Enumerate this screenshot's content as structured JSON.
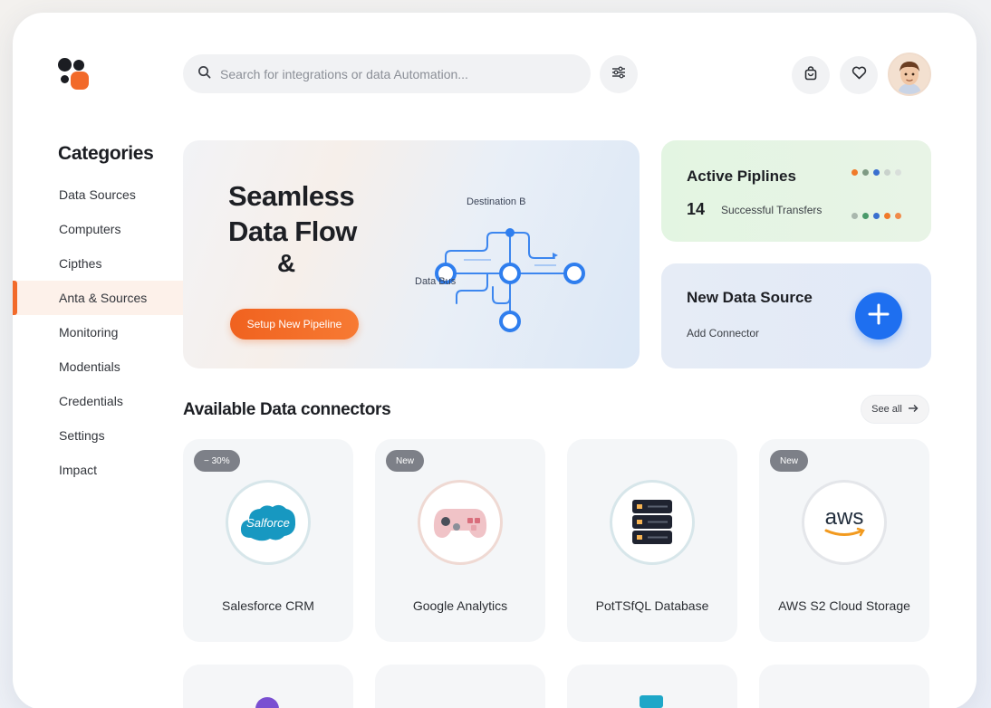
{
  "search": {
    "placeholder": "Search for integrations or data Automation..."
  },
  "header": {
    "filter_icon": "sliders-icon",
    "bag_icon": "shopping-bag-icon",
    "heart_icon": "heart-icon",
    "avatar_icon": "user-avatar"
  },
  "sidebar": {
    "title": "Categories",
    "items": [
      {
        "label": "Data Sources"
      },
      {
        "label": "Computers"
      },
      {
        "label": "Cipthes"
      },
      {
        "label": "Anta & Sources",
        "active": true
      },
      {
        "label": "Monitoring"
      },
      {
        "label": "Modentials"
      },
      {
        "label": "Credentials"
      },
      {
        "label": "Settings"
      },
      {
        "label": "Impact"
      }
    ]
  },
  "hero": {
    "title_line1": "Seamless",
    "title_line2": "Data Flow",
    "title_amp": "&",
    "button_label": "Setup New Pipeline",
    "diagram_label_top": "Destination B",
    "diagram_label_left": "Data Bus"
  },
  "active_pipelines": {
    "title": "Active Piplines",
    "count": "14",
    "subtitle": "Successful Transfers"
  },
  "new_source": {
    "title": "New Data Source",
    "subtitle": "Add Connector"
  },
  "connectors": {
    "title": "Available Data connectors",
    "see_all": "See all",
    "items": [
      {
        "name": "Salesforce CRM",
        "badge": "− 30%",
        "logo_text": "Salforce"
      },
      {
        "name": "Google Analytics",
        "badge": "New",
        "logo_text": ""
      },
      {
        "name": "PotTSfQL Database",
        "badge": "",
        "logo_text": ""
      },
      {
        "name": "AWS S2 Cloud Storage",
        "badge": "New",
        "logo_text": "aws"
      }
    ]
  },
  "colors": {
    "accent": "#f26a2a",
    "primary_blue": "#1e6ff0",
    "pipeline_card": "#e3f5e2",
    "new_source_card": "#e3eaf7"
  }
}
